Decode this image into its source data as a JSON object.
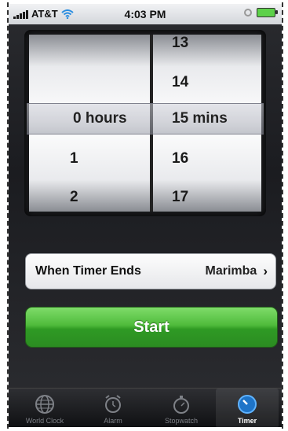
{
  "status_bar": {
    "carrier": "AT&T",
    "time": "4:03 PM"
  },
  "picker": {
    "hours_column": [
      "1",
      "2"
    ],
    "hours_selected": "0 hours",
    "mins_column": [
      "13",
      "14",
      "16",
      "17"
    ],
    "mins_selected": "15 mins"
  },
  "when_timer_ends": {
    "label": "When Timer Ends",
    "value": "Marimba",
    "chevron": "›"
  },
  "start_button": {
    "label": "Start",
    "color": "#3ea92f"
  },
  "tabs": [
    {
      "label": "World Clock",
      "icon": "globe-icon"
    },
    {
      "label": "Alarm",
      "icon": "alarm-clock-icon"
    },
    {
      "label": "Stopwatch",
      "icon": "stopwatch-icon"
    },
    {
      "label": "Timer",
      "icon": "timer-icon",
      "active": true
    }
  ],
  "colors": {
    "accent_blue": "#2a8de0",
    "tab_inactive": "#7e8187"
  }
}
